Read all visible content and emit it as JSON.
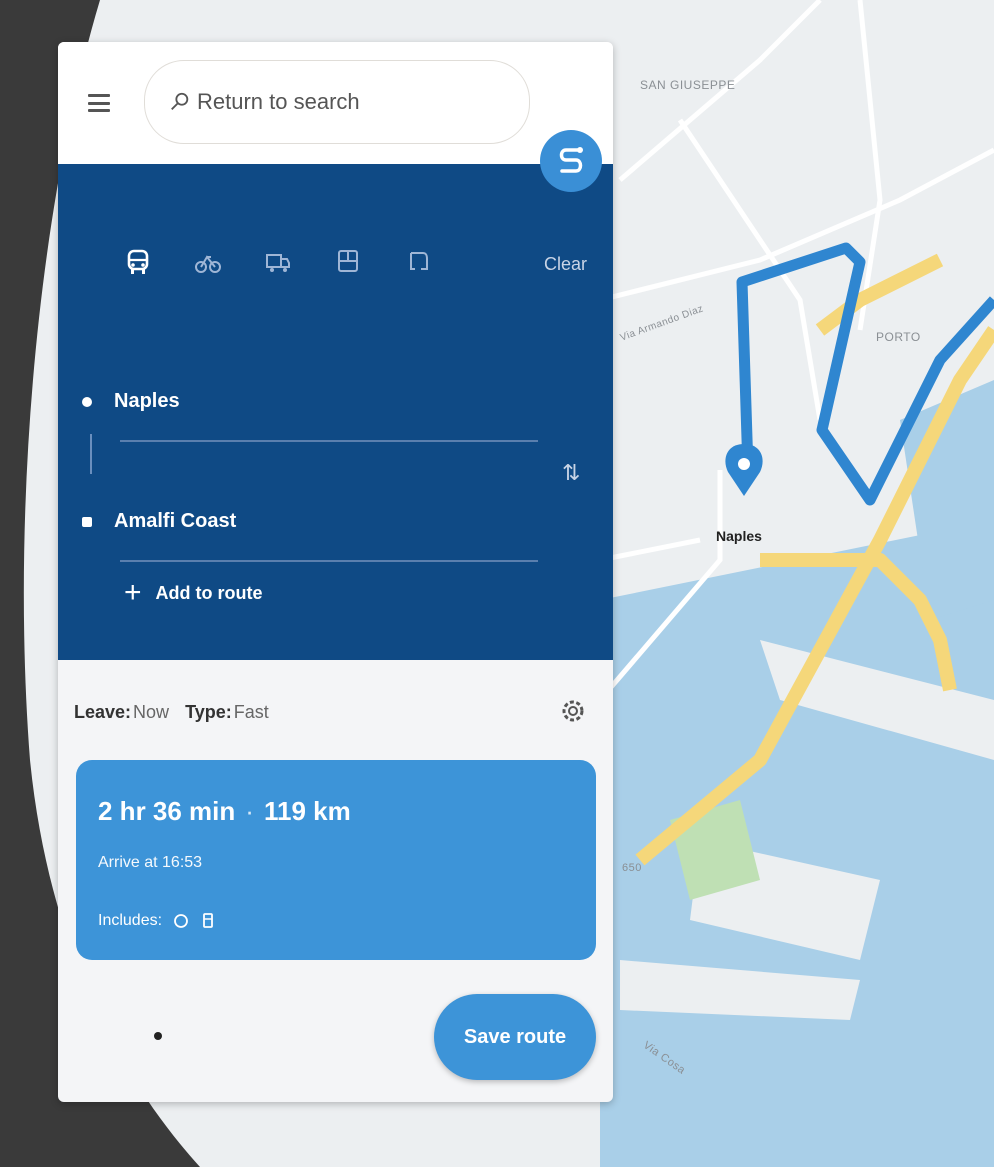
{
  "map": {
    "labels": {
      "san_giuseppe": "SAN GIUSEPPE",
      "porto": "PORTO",
      "street_left": "Via Armando Diaz",
      "street_bottom": "Via Cosa",
      "city": "Naples",
      "edge_number": "650"
    },
    "route_color": "#2f86d0",
    "highway_color": "#f5d77a",
    "water_color": "#a9cfe8",
    "park_color": "#bfe0b4"
  },
  "panel": {
    "search": {
      "placeholder": "Return to search",
      "icon": "search-icon"
    },
    "menu_icon": "menu-icon",
    "route_fab_icon": "route-icon",
    "transport_modes": [
      "car-icon",
      "bicycle-icon",
      "truck-icon",
      "bus-icon",
      "pedestrian-icon"
    ],
    "clear_label": "Clear",
    "waypoints": {
      "origin": "Naples",
      "destination": "Amalfi Coast"
    },
    "swap_icon": "swap-icon",
    "add_to_route_label": "Add to route",
    "options": {
      "leave_label": "Leave:",
      "leave_value": "Now",
      "type_label": "Type:",
      "type_value": "Fast"
    },
    "settings_icon": "gear-icon",
    "result": {
      "duration": "2 hr 36 min",
      "separator": "·",
      "distance": "119 km",
      "arrive": "Arrive at 16:53",
      "includes_label": "Includes:"
    },
    "save_route_label": "Save route",
    "colors": {
      "blue_dark": "#0f4a85",
      "blue_accent": "#3d94d8"
    }
  }
}
